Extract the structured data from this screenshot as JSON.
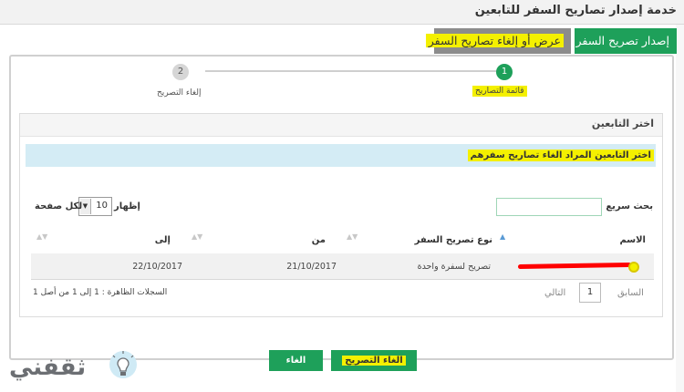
{
  "header": {
    "title": "خدمة إصدار تصاريح السفر للتابعين"
  },
  "tabs": [
    {
      "label": "إصدار تصريح السفر",
      "active": true
    },
    {
      "label": "عرض أو إلغاء تصاريح السفر",
      "active": false
    }
  ],
  "wizard": {
    "steps": [
      {
        "num": "1",
        "label": "قائمة التصاريح",
        "active": true
      },
      {
        "num": "2",
        "label": "إلغاء التصريح",
        "active": false
      }
    ]
  },
  "panel": {
    "title": "اختر التابعين",
    "instruction": "اختر التابعين المراد الغاء تصاريح سفرهم"
  },
  "table_controls": {
    "search_label": "بحث سريع :",
    "search_value": "",
    "show_label": "إظهار",
    "page_length": "10",
    "per_page_label": "لكل صفحة"
  },
  "table": {
    "columns": [
      "الاسم",
      "نوع تصريح السفر",
      "من",
      "إلى"
    ],
    "rows": [
      {
        "name": "",
        "type": "تصريح لسفرة واحدة",
        "from": "21/10/2017",
        "to": "22/10/2017"
      }
    ]
  },
  "pagination": {
    "info": "السجلات الظاهرة : 1 إلى 1 من أصل 1",
    "prev_label": "السابق",
    "current_page": "1",
    "next_label": "التالي"
  },
  "buttons": {
    "revoke_label": "الغاء التصريح",
    "cancel_label": "الغاء"
  },
  "logo": {
    "text": "ثقفني"
  },
  "colors": {
    "accent_green": "#1ea05a",
    "tab_gray": "#8c8c8c",
    "highlight_yellow": "#f4f000",
    "alert_blue": "#d4ecf5",
    "redaction_red": "#ff0000"
  },
  "icons": [
    "sort-asc-icon",
    "sort-both-icon",
    "dropdown-arrow-icon",
    "lightbulb-icon"
  ]
}
